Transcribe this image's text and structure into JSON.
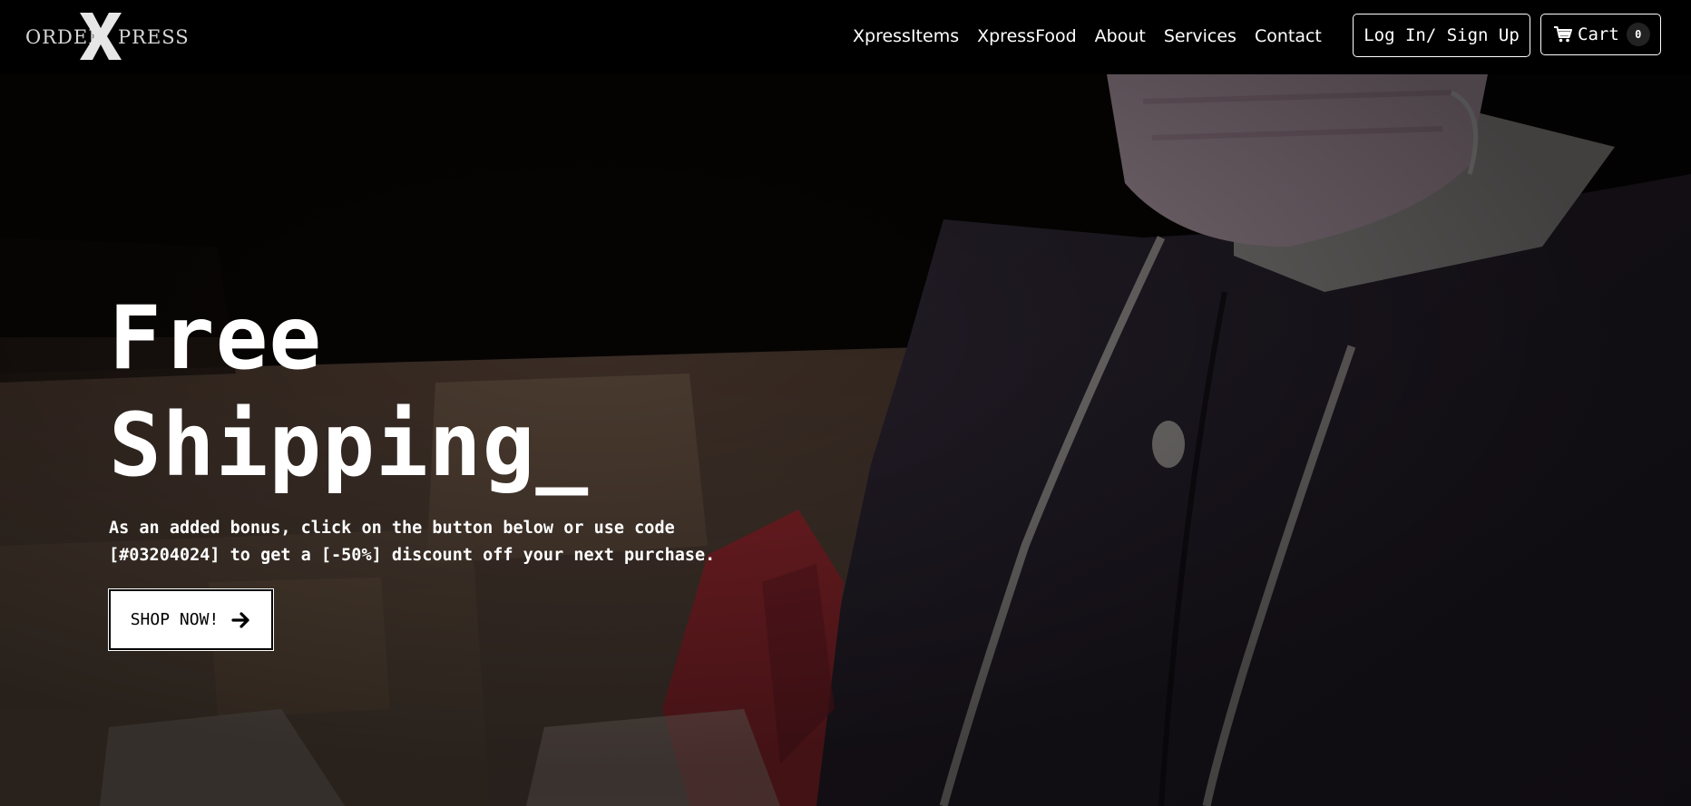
{
  "brand": {
    "word_left": "ORDER",
    "letter": "X",
    "word_right": "PRESS"
  },
  "nav": {
    "links": [
      "XpressItems",
      "XpressFood",
      "About",
      "Services",
      "Contact"
    ],
    "login_label": "Log In/ Sign Up",
    "cart_label": "Cart",
    "cart_count": "0"
  },
  "hero": {
    "title_line1": "Free",
    "title_line2": "Shipping_",
    "text": "As an added bonus, click on the button below or use code [#03204024] to get a [-50%] discount off your next purchase.",
    "cta_label": "SHOP NOW!"
  },
  "icons": {
    "cart": "cart-icon",
    "arrow": "arrow-right-icon"
  },
  "colors": {
    "nav_bg": "#000000",
    "text": "#ffffff",
    "cta_bg": "#ffffff",
    "jacket_accent": "#c8343a"
  }
}
